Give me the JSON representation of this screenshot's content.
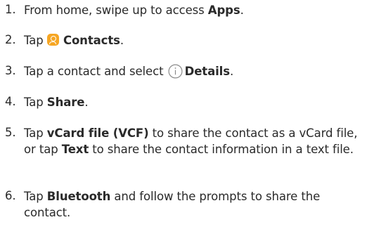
{
  "steps": [
    {
      "number": "1.",
      "parts": [
        "From home, swipe up to access ",
        "Apps",
        "."
      ]
    },
    {
      "number": "2.",
      "parts": [
        "Tap ",
        "Contacts",
        "."
      ],
      "icon": "contacts-app-icon"
    },
    {
      "number": "3.",
      "parts": [
        "Tap a contact and select ",
        "Details",
        "."
      ],
      "icon": "info-icon"
    },
    {
      "number": "4.",
      "parts": [
        "Tap ",
        "Share",
        "."
      ]
    },
    {
      "number": "5.",
      "parts": [
        "Tap ",
        "vCard file (VCF)",
        " to share the contact as a vCard file, or tap ",
        "Text",
        " to share the contact information in a text file."
      ]
    },
    {
      "number": "6.",
      "parts": [
        "Tap ",
        "Bluetooth",
        " and follow the prompts to share the contact."
      ]
    }
  ],
  "colors": {
    "text": "#2a2a2a",
    "contacts_icon_bg": "#f6a623",
    "info_icon_stroke": "#8a8a8a"
  }
}
